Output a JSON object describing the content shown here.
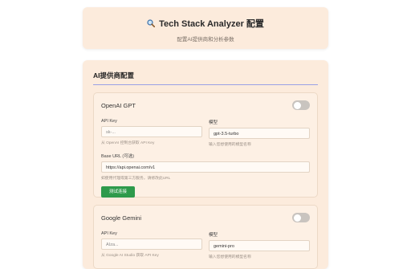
{
  "header": {
    "title": "Tech Stack Analyzer 配置",
    "subtitle": "配置AI提供商和分析参数",
    "icon": "magnifier-icon"
  },
  "main": {
    "section_title": "AI提供商配置",
    "providers": [
      {
        "name": "OpenAI GPT",
        "enabled": false,
        "api_key_label": "API Key",
        "api_key_placeholder": "sk-...",
        "api_key_hint": "从 OpenAI 控制台获取 API Key",
        "model_label": "模型",
        "model_value": "gpt-3.5-turbo",
        "model_hint": "输入您想使用的模型名称",
        "base_url_label": "Base URL (可选)",
        "base_url_value": "https://api.openai.com/v1",
        "base_url_hint": "如使用代理或第三方服务，请修改此URL",
        "test_button": "测试连接"
      },
      {
        "name": "Google Gemini",
        "enabled": false,
        "api_key_label": "API Key",
        "api_key_placeholder": "AIza...",
        "api_key_hint": "从 Google AI Studio 获取 API Key",
        "model_label": "模型",
        "model_value": "gemini-pro",
        "model_hint": "输入您想使用的模型名称"
      }
    ]
  },
  "colors": {
    "card_bg": "#fcebdc",
    "accent_line": "#9aa0e6",
    "button_green": "#2e9a4b",
    "toggle_off": "#c9c4bf"
  }
}
